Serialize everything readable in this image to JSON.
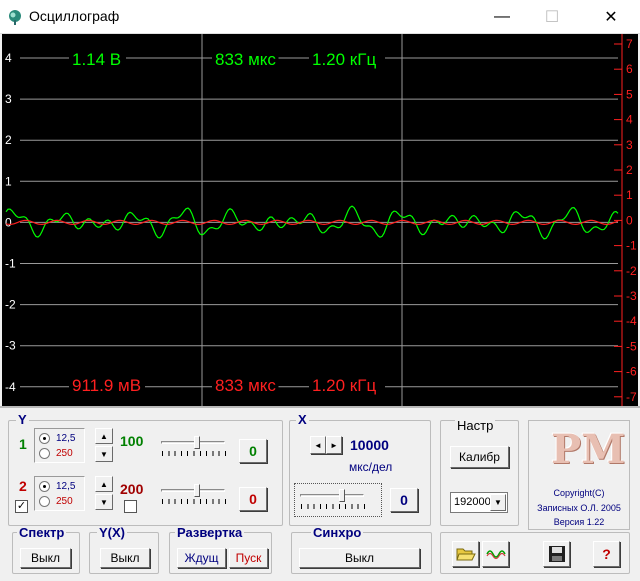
{
  "window": {
    "title": "Осциллограф",
    "minimize_glyph": "—",
    "maximize_glyph": "☐",
    "close_glyph": "✕"
  },
  "scope": {
    "background": "#000000",
    "ch1_color": "#00ff00",
    "ch2_color": "#ff2020",
    "left_axis": [
      "4",
      "3",
      "2",
      "1",
      "0",
      "-1",
      "-2",
      "-3",
      "-4"
    ],
    "right_axis": [
      "7",
      "6",
      "5",
      "4",
      "3",
      "2",
      "1",
      "0",
      "-1",
      "-2",
      "-3",
      "-4",
      "-5",
      "-6",
      "-7"
    ],
    "top_readout": {
      "amplitude": "1.14 В",
      "period": "833 мкс",
      "frequency": "1.20 кГц"
    },
    "bottom_readout": {
      "amplitude": "911.9 мВ",
      "period": "833 мкс",
      "frequency": "1.20 кГц"
    }
  },
  "y_group": {
    "label": "Y",
    "ch1": {
      "number": "1",
      "range_opts": [
        "12,5",
        "250"
      ],
      "selected": "12,5",
      "scale": "100",
      "offset_button": "0"
    },
    "ch2": {
      "number": "2",
      "range_opts": [
        "12,5",
        "250"
      ],
      "selected": "12,5",
      "scale": "200",
      "offset_button": "0",
      "enabled": true,
      "enabled_mark": "✓"
    }
  },
  "x_group": {
    "label": "X",
    "timebase_value": "10000",
    "timebase_unit": "мкс/дел",
    "offset_button": "0"
  },
  "setup_group": {
    "label": "Настр",
    "calibrate_button": "Калибр",
    "sample_rate": "192000"
  },
  "logo": {
    "text": "PM",
    "copyright": "Copyright(C)",
    "author": "Записных О.Л. 2005",
    "version": "Версия 1.22"
  },
  "spectrum_group": {
    "label": "Спектр",
    "button": "Выкл"
  },
  "yx_group": {
    "label": "Y(X)",
    "button": "Выкл"
  },
  "sweep_group": {
    "label": "Развертка",
    "wait_button": "Ждущ",
    "start_button": "Пуск"
  },
  "sync_group": {
    "label": "Синхро",
    "button": "Выкл"
  },
  "toolbar": {
    "help_label": "?"
  },
  "icons": [
    "app-icon",
    "open-folder-icon",
    "waveform-icon",
    "save-disk-icon"
  ]
}
